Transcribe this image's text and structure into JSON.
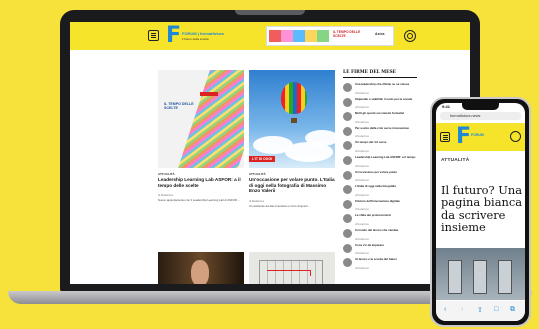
{
  "laptop": {
    "banner_text": "IL TEMPO DELLE SCELTE",
    "banner_logo": "Axios",
    "logo_text": "FORUM | formatfutura",
    "logo_sub": "il futuro della scuola"
  },
  "articles": [
    {
      "category": "ATTUALITÀ",
      "headline": "Leadership Learning Lab ASFOR: a il tempo delle scelte",
      "meta": "di Redazione",
      "excerpt": "Nuovo appuntamento con il Leadership Learning Lab di ASFOR ..."
    },
    {
      "category": "ATTUALITÀ",
      "headline": "Un'occasione per volare punto. L'Italia di oggi nella fotografia di Massimo Enzo Valerii",
      "meta": "di Redazione",
      "excerpt": "Un ambiente ad alto innovativo e ricco di spunti ..."
    }
  ],
  "image_tag": "L'IT DI OGGI",
  "sidebar": {
    "title": "LE FIRME DEL MESE",
    "items": [
      {
        "title": "Una leadership che riflette su sé stessa",
        "meta": "di Redazione"
      },
      {
        "title": "Stipendio e stabilità: il nodo per la scuola",
        "meta": "di Redazione"
      },
      {
        "title": "Molti gli spunti sui sistemi formativi",
        "meta": "di Redazione"
      },
      {
        "title": "Per uscire dalla crisi serve innovazione",
        "meta": "di Redazione"
      },
      {
        "title": "Un tempo del 4.0 serve",
        "meta": "di Redazione"
      },
      {
        "title": "Leadership Learning Lab ASFOR: a il tempo",
        "meta": "di Redazione"
      },
      {
        "title": "Un'occasione per volare punto",
        "meta": "di Redazione"
      },
      {
        "title": "L'Italia di oggi nella fotografia",
        "meta": "di Redazione"
      },
      {
        "title": "Il futuro dell'innovazione digitale",
        "meta": "di Redazione"
      },
      {
        "title": "La sfida dei professionisti",
        "meta": "di Redazione"
      },
      {
        "title": "Il mondo del lavoro che cambia",
        "meta": "di Redazione"
      },
      {
        "title": "Cosa c'è da imparare",
        "meta": "di Redazione"
      },
      {
        "title": "Al lavoro e la scuola del futuro",
        "meta": "di Redazione"
      }
    ]
  },
  "phone": {
    "time": "9:41",
    "url": "formatfutura.news",
    "logo_text": "FORUM",
    "category": "ATTUALITÀ",
    "title": "Il futuro? Una pagina bianca da scrivere insieme"
  }
}
